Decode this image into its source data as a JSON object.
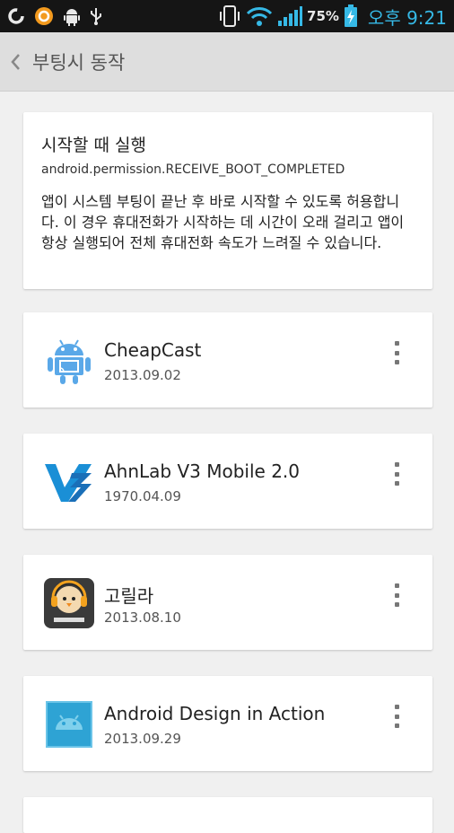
{
  "status_bar": {
    "battery_percent": "75%",
    "time": "오후 9:21",
    "icons": [
      "g-icon",
      "circle-app-icon",
      "android-debug-icon",
      "usb-icon",
      "phone-vibrate-icon",
      "wifi-icon",
      "signal-icon",
      "battery-charging-icon"
    ]
  },
  "action_bar": {
    "back_icon": "chevron-left-icon",
    "title": "부팅시 동작"
  },
  "permission": {
    "title": "시작할 때 실행",
    "name": "android.permission.RECEIVE_BOOT_COMPLETED",
    "description": "앱이 시스템 부팅이 끝난 후 바로 시작할 수 있도록 허용합니다. 이 경우 휴대전화가 시작하는 데 시간이 오래 걸리고 앱이 항상 실행되어 전체 휴대전화 속도가 느려질 수 있습니다."
  },
  "apps": [
    {
      "name": "CheapCast",
      "date": "2013.09.02",
      "icon": "android-cast-icon"
    },
    {
      "name": "AhnLab V3 Mobile 2.0",
      "date": "1970.04.09",
      "icon": "v3-logo-icon"
    },
    {
      "name": "고릴라",
      "date": "2013.08.10",
      "icon": "gorealra-penguin-icon"
    },
    {
      "name": "Android Design in Action",
      "date": "2013.09.29",
      "icon": "android-design-icon"
    }
  ],
  "colors": {
    "accent": "#36b9e6",
    "action_bar": "#dedede",
    "background": "#f0f0f0"
  }
}
